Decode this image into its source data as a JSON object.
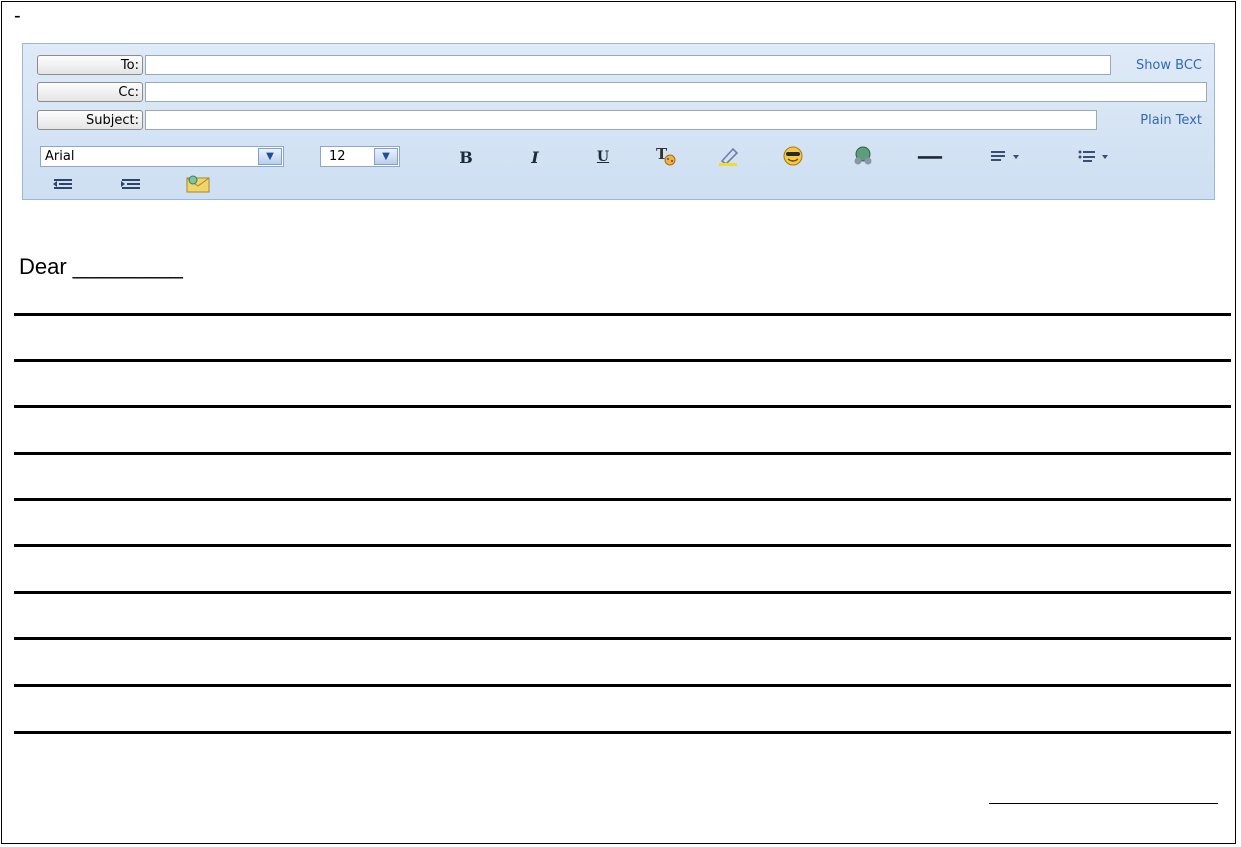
{
  "page": {
    "mark": "-"
  },
  "composer": {
    "to_label": "To:",
    "cc_label": "Cc:",
    "subject_label": "Subject:",
    "to_value": "",
    "cc_value": "",
    "subject_value": "",
    "show_bcc": "Show BCC",
    "plain_text": "Plain Text"
  },
  "toolbar": {
    "font": "Arial",
    "size": "12",
    "icons": [
      "bold-icon",
      "italic-icon",
      "underline-icon",
      "text-color-icon",
      "highlight-icon",
      "emoticon-icon",
      "insert-image-icon",
      "horizontal-rule-icon",
      "align-icon",
      "list-icon",
      "outdent-icon",
      "indent-icon",
      "stationery-icon"
    ]
  },
  "letter": {
    "greeting": "Dear _________",
    "writing_lines": 11
  },
  "colors": {
    "toolbar_bg": "#d5e4f5",
    "link": "#2f6ab7"
  }
}
